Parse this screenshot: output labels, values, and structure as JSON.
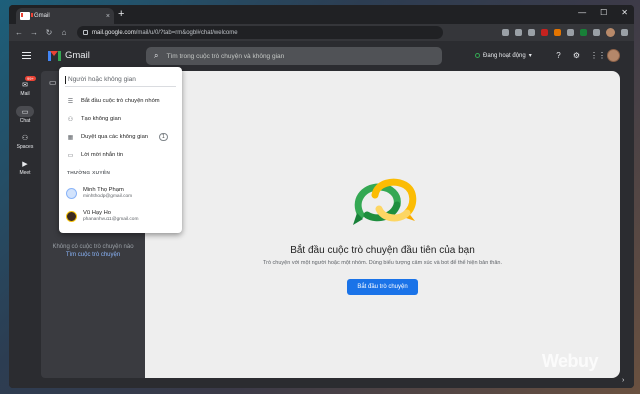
{
  "browser": {
    "tab_title": "Gmail",
    "tab_close": "×",
    "new_tab": "+",
    "url_host": "mail.google.com",
    "url_path": "/mail/u/0/?tab=rm&ogbl#chat/welcome",
    "controls": {
      "minimize": "—",
      "maximize": "☐",
      "close": "✕"
    },
    "nav": {
      "back": "←",
      "forward": "→",
      "reload": "↻",
      "home": "⌂"
    }
  },
  "gmail": {
    "app_name": "Gmail",
    "search_placeholder": "Tìm trong cuộc trò chuyện và không gian",
    "status_label": "Đang hoạt động",
    "status_caret": "▾",
    "status_color": "#34a853"
  },
  "rail": [
    {
      "label": "Mail",
      "icon": "mail-icon",
      "glyph": "✉",
      "badge": "99+",
      "active": false
    },
    {
      "label": "Chat",
      "icon": "chat-icon",
      "glyph": "▭",
      "active": true
    },
    {
      "label": "Spaces",
      "icon": "spaces-icon",
      "glyph": "⚇",
      "active": false
    },
    {
      "label": "Meet",
      "icon": "meet-icon",
      "glyph": "▶",
      "active": false
    }
  ],
  "left_panel": {
    "empty_text": "Không có cuộc trò chuyện nào",
    "empty_link": "Tìm cuộc trò chuyện"
  },
  "dropdown": {
    "search_placeholder": "Người hoặc không gian",
    "items": [
      {
        "label": "Bắt đầu cuộc trò chuyện nhóm",
        "icon": "group-chat-icon",
        "glyph": "☰"
      },
      {
        "label": "Tạo không gian",
        "icon": "create-space-icon",
        "glyph": "⚇"
      },
      {
        "label": "Duyệt qua các không gian",
        "icon": "browse-spaces-icon",
        "glyph": "▦",
        "count": "1"
      },
      {
        "label": "Lời mời nhắn tin",
        "icon": "message-request-icon",
        "glyph": "▭"
      }
    ],
    "section_title": "THƯỜNG XUYÊN",
    "people": [
      {
        "name": "Minh Thọ Phạm",
        "email": "minhthodp@gmail.com"
      },
      {
        "name": "Vũ Hạy Ho",
        "email": "phananhvu11@gmail.com"
      }
    ]
  },
  "main": {
    "heading": "Bắt đầu cuộc trò chuyện đầu tiên của bạn",
    "subtext": "Trò chuyện với một người hoặc một nhóm. Dùng biểu tượng cảm xúc và bot để thể hiện bản thân.",
    "cta_label": "Bắt đầu trò chuyện"
  },
  "watermark": "Webuy",
  "colors": {
    "accent": "#1a73e8",
    "brand_red": "#ea4335",
    "chat_green": "#34a853",
    "chat_yellow": "#fbbc04"
  }
}
